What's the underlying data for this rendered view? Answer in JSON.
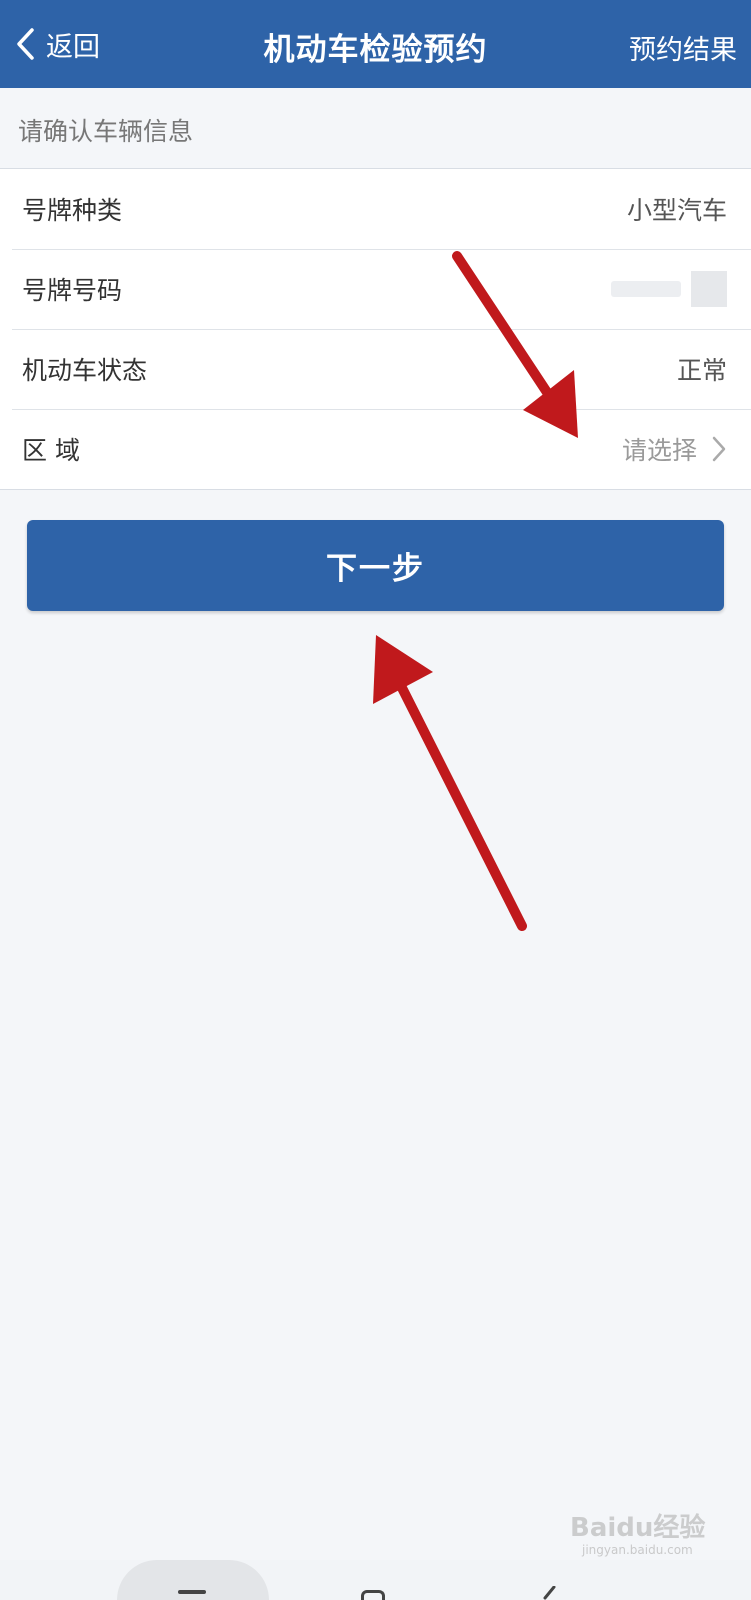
{
  "header": {
    "back_label": "返回",
    "title": "机动车检验预约",
    "result_link": "预约结果",
    "background_color": "#2e63a8"
  },
  "section_hint": "请确认车辆信息",
  "vehicle_info": {
    "plate_type": {
      "label": "号牌种类",
      "value": "小型汽车"
    },
    "plate_number": {
      "label": "号牌号码"
    },
    "vehicle_status": {
      "label": "机动车状态",
      "value": "正常"
    },
    "region": {
      "label": "区 域",
      "placeholder": "请选择"
    }
  },
  "next_button": {
    "label": "下一步"
  },
  "annotation_color": "#c0191c",
  "watermark": {
    "brand": "Baidu经验",
    "url": "jingyan.baidu.com"
  },
  "icons": [
    "chevron-left-icon",
    "chevron-right-icon",
    "nav-menu-icon",
    "nav-home-icon",
    "nav-back-icon"
  ]
}
